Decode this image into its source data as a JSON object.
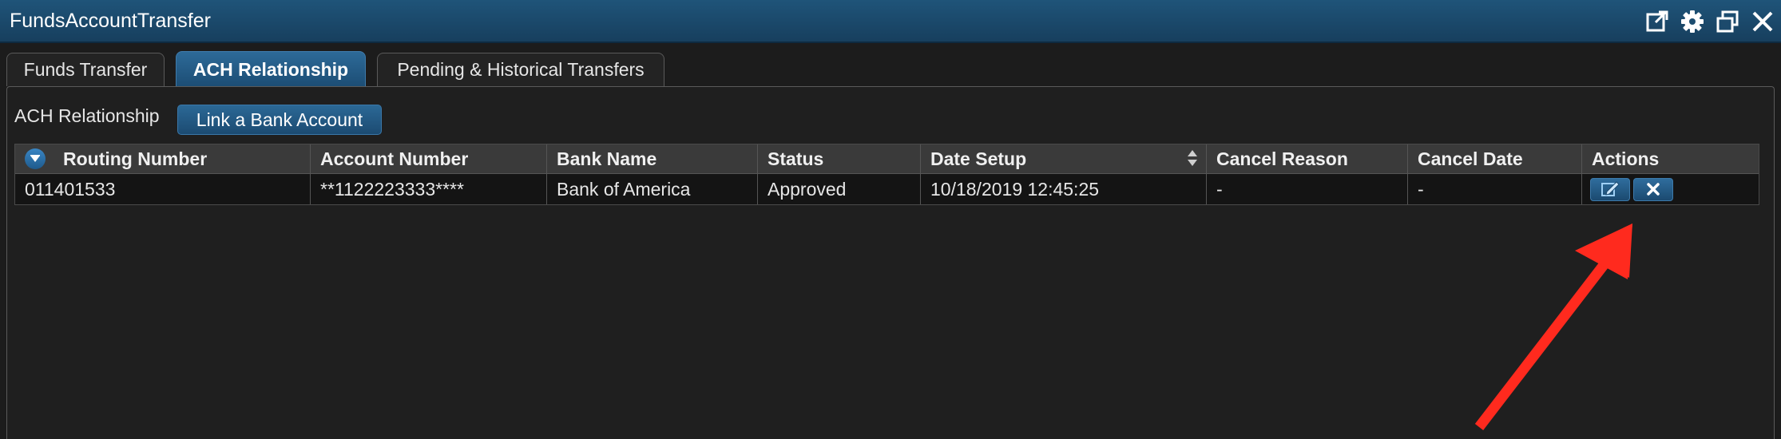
{
  "window": {
    "title": "FundsAccountTransfer",
    "controls": [
      "popout-icon",
      "gear-icon",
      "restore-icon",
      "close-icon"
    ]
  },
  "tabs": [
    {
      "label": "Funds Transfer",
      "active": false
    },
    {
      "label": "ACH Relationship",
      "active": true
    },
    {
      "label": "Pending & Historical Transfers",
      "active": false
    }
  ],
  "section": {
    "label": "ACH Relationship",
    "link_button": "Link a Bank Account"
  },
  "table": {
    "columns": [
      "Routing Number",
      "Account Number",
      "Bank Name",
      "Status",
      "Date Setup",
      "Cancel Reason",
      "Cancel Date",
      "Actions"
    ],
    "rows": [
      {
        "routing_number": "011401533",
        "account_number": "**1122223333****",
        "bank_name": "Bank of America",
        "status": "Approved",
        "date_setup": "10/18/2019 12:45:25",
        "cancel_reason": "-",
        "cancel_date": "-",
        "actions": [
          "edit-icon",
          "cancel-x-icon"
        ]
      }
    ]
  },
  "colors": {
    "titlebar": "#1f5479",
    "accent_button": "#2b6896",
    "annotation_arrow": "#ff2a1e"
  }
}
